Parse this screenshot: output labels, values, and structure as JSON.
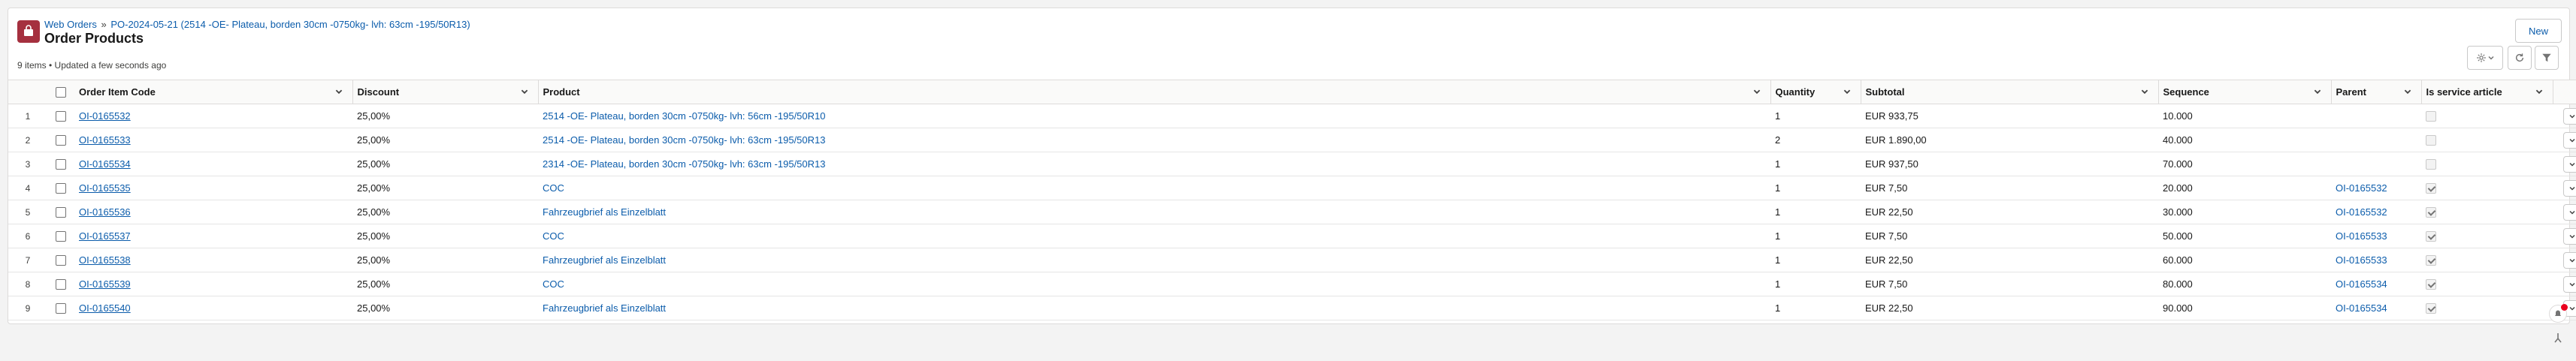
{
  "breadcrumb": {
    "parent": "Web Orders",
    "separator": "»",
    "record": "PO-2024-05-21 (2514 -OE- Plateau, borden 30cm -0750kg- lvh: 63cm -195/50R13)"
  },
  "page_title": "Order Products",
  "meta_text": "9 items • Updated a few seconds ago",
  "buttons": {
    "new_label": "New"
  },
  "columns": [
    "Order Item Code",
    "Discount",
    "Product",
    "Quantity",
    "Subtotal",
    "Sequence",
    "Parent",
    "Is service article"
  ],
  "rows": [
    {
      "num": "1",
      "code": "OI-0165532",
      "discount": "25,00%",
      "product": "2514 -OE- Plateau, borden 30cm -0750kg- lvh: 56cm -195/50R10",
      "quantity": "1",
      "subtotal": "EUR 933,75",
      "sequence": "10.000",
      "parent": "",
      "service": false
    },
    {
      "num": "2",
      "code": "OI-0165533",
      "discount": "25,00%",
      "product": "2514 -OE- Plateau, borden 30cm -0750kg- lvh: 63cm -195/50R13",
      "quantity": "2",
      "subtotal": "EUR 1.890,00",
      "sequence": "40.000",
      "parent": "",
      "service": false
    },
    {
      "num": "3",
      "code": "OI-0165534",
      "discount": "25,00%",
      "product": "2314 -OE- Plateau, borden 30cm -0750kg- lvh: 63cm -195/50R13",
      "quantity": "1",
      "subtotal": "EUR 937,50",
      "sequence": "70.000",
      "parent": "",
      "service": false
    },
    {
      "num": "4",
      "code": "OI-0165535",
      "discount": "25,00%",
      "product": "COC",
      "quantity": "1",
      "subtotal": "EUR 7,50",
      "sequence": "20.000",
      "parent": "OI-0165532",
      "service": true
    },
    {
      "num": "5",
      "code": "OI-0165536",
      "discount": "25,00%",
      "product": "Fahrzeugbrief als Einzelblatt",
      "quantity": "1",
      "subtotal": "EUR 22,50",
      "sequence": "30.000",
      "parent": "OI-0165532",
      "service": true
    },
    {
      "num": "6",
      "code": "OI-0165537",
      "discount": "25,00%",
      "product": "COC",
      "quantity": "1",
      "subtotal": "EUR 7,50",
      "sequence": "50.000",
      "parent": "OI-0165533",
      "service": true
    },
    {
      "num": "7",
      "code": "OI-0165538",
      "discount": "25,00%",
      "product": "Fahrzeugbrief als Einzelblatt",
      "quantity": "1",
      "subtotal": "EUR 22,50",
      "sequence": "60.000",
      "parent": "OI-0165533",
      "service": true
    },
    {
      "num": "8",
      "code": "OI-0165539",
      "discount": "25,00%",
      "product": "COC",
      "quantity": "1",
      "subtotal": "EUR 7,50",
      "sequence": "80.000",
      "parent": "OI-0165534",
      "service": true
    },
    {
      "num": "9",
      "code": "OI-0165540",
      "discount": "25,00%",
      "product": "Fahrzeugbrief als Einzelblatt",
      "quantity": "1",
      "subtotal": "EUR 22,50",
      "sequence": "90.000",
      "parent": "OI-0165534",
      "service": true
    }
  ],
  "colors": {
    "brand_icon": "#a5303f",
    "link": "#0b5cab",
    "notification_badge": "#ea001e"
  },
  "icons": [
    "orders-icon",
    "gear-icon",
    "refresh-icon",
    "filter-icon",
    "chevron-down-icon",
    "notification-icon",
    "tool-icon"
  ]
}
